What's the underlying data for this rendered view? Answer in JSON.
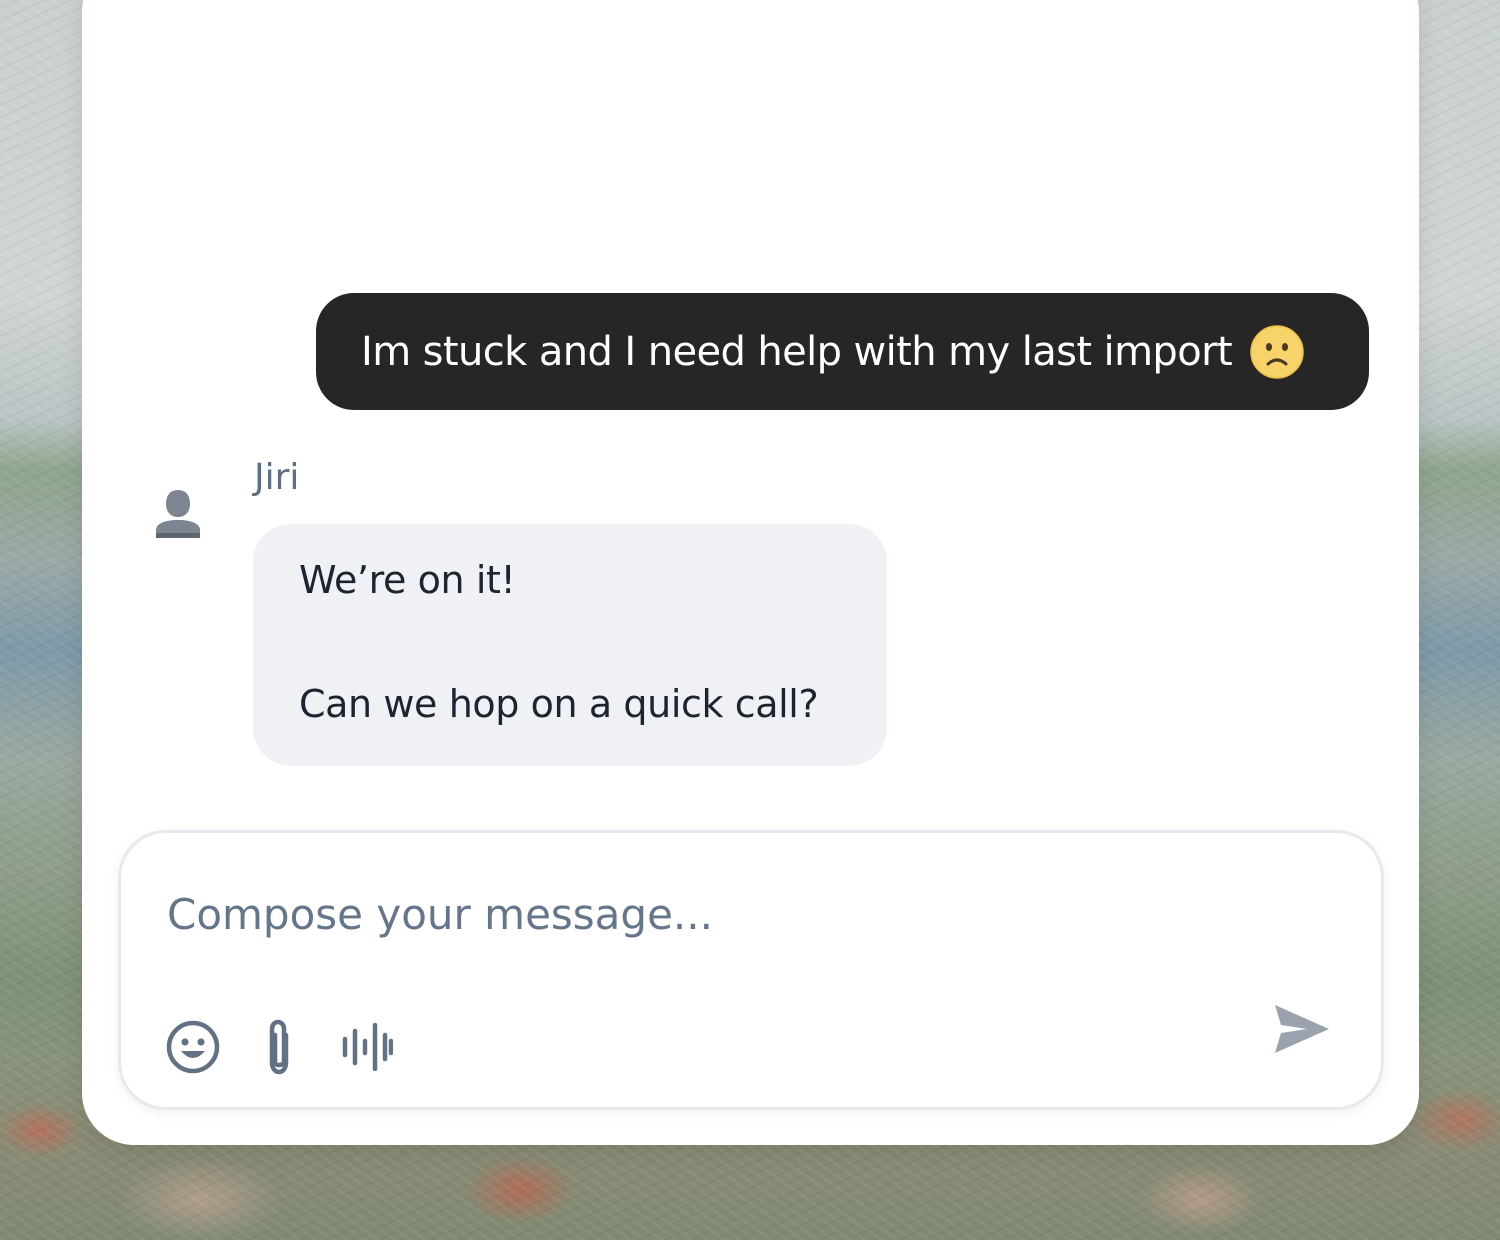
{
  "conversation": {
    "user_message": {
      "text": "Im stuck and I need help with my last import",
      "emoji": "slightly-frowning-face"
    },
    "agent_message": {
      "sender": "Jiri",
      "avatar_icon": "user-silhouette-icon",
      "lines": [
        "We’re on it!",
        "Can we hop on a quick call?"
      ]
    }
  },
  "composer": {
    "placeholder": "Compose your message...",
    "value": "",
    "tools": [
      "emoji-icon",
      "paperclip-icon",
      "voice-waveform-icon"
    ],
    "send_icon": "send-icon"
  },
  "colors": {
    "user_bubble": "#262626",
    "agent_bubble": "#f0f1f5",
    "muted_text": "#65758a",
    "icon_gray": "#627184"
  }
}
